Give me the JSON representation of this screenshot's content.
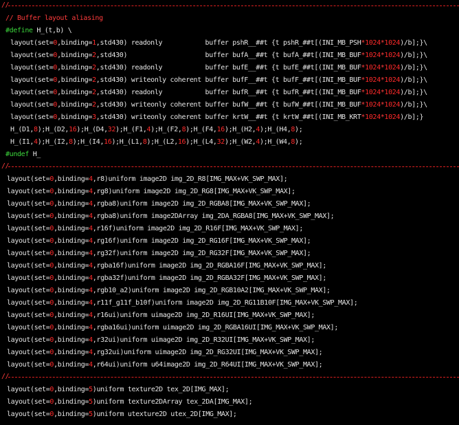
{
  "palette": {
    "background": "#000000",
    "text": "#e6e6e6",
    "number": "#ff2a2a",
    "comment": "#ff3c3c",
    "preprocessor": "#3cd83c"
  },
  "editor": {
    "lines": [
      {
        "kind": "sep",
        "text": "//"
      },
      {
        "kind": "code",
        "x": 8,
        "segments": [
          [
            "comment",
            "// Buffer layout aliasing"
          ]
        ]
      },
      {
        "kind": "code",
        "x": 8,
        "segments": [
          [
            "pp",
            "#define"
          ],
          [
            "plain",
            " H_(t,b) \\"
          ]
        ]
      },
      {
        "kind": "code",
        "x": 15,
        "segments": [
          [
            "plain",
            "layout(set="
          ],
          [
            "num",
            "0"
          ],
          [
            "plain",
            ",binding="
          ],
          [
            "num",
            "1"
          ],
          [
            "plain",
            ",std430) readonly           buffer pshR__##t {t pshR_##t[(INI_MB_PSH"
          ],
          [
            "op",
            "*"
          ],
          [
            "num",
            "1024"
          ],
          [
            "op",
            "*"
          ],
          [
            "num",
            "1024"
          ],
          [
            "plain",
            ")/b];}\\"
          ]
        ]
      },
      {
        "kind": "code",
        "x": 15,
        "segments": [
          [
            "plain",
            "layout(set="
          ],
          [
            "num",
            "0"
          ],
          [
            "plain",
            ",binding="
          ],
          [
            "num",
            "2"
          ],
          [
            "plain",
            ",std430)                    buffer bufA__##t {t bufA_##t[(INI_MB_BUF"
          ],
          [
            "op",
            "*"
          ],
          [
            "num",
            "1024"
          ],
          [
            "op",
            "*"
          ],
          [
            "num",
            "1024"
          ],
          [
            "plain",
            ")/b];}\\"
          ]
        ]
      },
      {
        "kind": "code",
        "x": 15,
        "segments": [
          [
            "plain",
            "layout(set="
          ],
          [
            "num",
            "0"
          ],
          [
            "plain",
            ",binding="
          ],
          [
            "num",
            "2"
          ],
          [
            "plain",
            ",std430) readonly           buffer bufE__##t {t bufE_##t[(INI_MB_BUF"
          ],
          [
            "op",
            "*"
          ],
          [
            "num",
            "1024"
          ],
          [
            "op",
            "*"
          ],
          [
            "num",
            "1024"
          ],
          [
            "plain",
            ")/b];}\\"
          ]
        ]
      },
      {
        "kind": "code",
        "x": 15,
        "segments": [
          [
            "plain",
            "layout(set="
          ],
          [
            "num",
            "0"
          ],
          [
            "plain",
            ",binding="
          ],
          [
            "num",
            "2"
          ],
          [
            "plain",
            ",std430) writeonly coherent buffer bufF__##t {t bufF_##t[(INI_MB_BUF"
          ],
          [
            "op",
            "*"
          ],
          [
            "num",
            "1024"
          ],
          [
            "op",
            "*"
          ],
          [
            "num",
            "1024"
          ],
          [
            "plain",
            ")/b];}\\"
          ]
        ]
      },
      {
        "kind": "code",
        "x": 15,
        "segments": [
          [
            "plain",
            "layout(set="
          ],
          [
            "num",
            "0"
          ],
          [
            "plain",
            ",binding="
          ],
          [
            "num",
            "2"
          ],
          [
            "plain",
            ",std430) readonly           buffer bufR__##t {t bufR_##t[(INI_MB_BUF"
          ],
          [
            "op",
            "*"
          ],
          [
            "num",
            "1024"
          ],
          [
            "op",
            "*"
          ],
          [
            "num",
            "1024"
          ],
          [
            "plain",
            ")/b];}\\"
          ]
        ]
      },
      {
        "kind": "code",
        "x": 15,
        "segments": [
          [
            "plain",
            "layout(set="
          ],
          [
            "num",
            "0"
          ],
          [
            "plain",
            ",binding="
          ],
          [
            "num",
            "2"
          ],
          [
            "plain",
            ",std430) writeonly coherent buffer bufW__##t {t bufW_##t[(INI_MB_BUF"
          ],
          [
            "op",
            "*"
          ],
          [
            "num",
            "1024"
          ],
          [
            "op",
            "*"
          ],
          [
            "num",
            "1024"
          ],
          [
            "plain",
            ")/b];}\\"
          ]
        ]
      },
      {
        "kind": "code",
        "x": 15,
        "segments": [
          [
            "plain",
            "layout(set="
          ],
          [
            "num",
            "0"
          ],
          [
            "plain",
            ",binding="
          ],
          [
            "num",
            "3"
          ],
          [
            "plain",
            ",std430) writeonly coherent buffer krtW__##t {t krtW_##t[(INI_MB_KRT"
          ],
          [
            "op",
            "*"
          ],
          [
            "num",
            "1024"
          ],
          [
            "op",
            "*"
          ],
          [
            "num",
            "1024"
          ],
          [
            "plain",
            ")/b];}"
          ]
        ]
      },
      {
        "kind": "code",
        "x": 15,
        "segments": [
          [
            "plain",
            "H_(D1,"
          ],
          [
            "num",
            "8"
          ],
          [
            "plain",
            ");H_(D2,"
          ],
          [
            "num",
            "16"
          ],
          [
            "plain",
            ");H_(D4,"
          ],
          [
            "num",
            "32"
          ],
          [
            "plain",
            ");H_(F1,"
          ],
          [
            "num",
            "4"
          ],
          [
            "plain",
            ");H_(F2,"
          ],
          [
            "num",
            "8"
          ],
          [
            "plain",
            ");H_(F4,"
          ],
          [
            "num",
            "16"
          ],
          [
            "plain",
            ");H_(H2,"
          ],
          [
            "num",
            "4"
          ],
          [
            "plain",
            ");H_(H4,"
          ],
          [
            "num",
            "8"
          ],
          [
            "plain",
            ");"
          ]
        ]
      },
      {
        "kind": "code",
        "x": 15,
        "segments": [
          [
            "plain",
            "H_(I1,"
          ],
          [
            "num",
            "4"
          ],
          [
            "plain",
            ");H_(I2,"
          ],
          [
            "num",
            "8"
          ],
          [
            "plain",
            ");H_(I4,"
          ],
          [
            "num",
            "16"
          ],
          [
            "plain",
            ");H_(L1,"
          ],
          [
            "num",
            "8"
          ],
          [
            "plain",
            ");H_(L2,"
          ],
          [
            "num",
            "16"
          ],
          [
            "plain",
            ");H_(L4,"
          ],
          [
            "num",
            "32"
          ],
          [
            "plain",
            ");H_(W2,"
          ],
          [
            "num",
            "4"
          ],
          [
            "plain",
            ");H_(W4,"
          ],
          [
            "num",
            "8"
          ],
          [
            "plain",
            ");"
          ]
        ]
      },
      {
        "kind": "code",
        "x": 8,
        "segments": [
          [
            "pp",
            "#undef"
          ],
          [
            "plain",
            " H_"
          ]
        ]
      },
      {
        "kind": "sep",
        "text": "//"
      },
      {
        "kind": "code",
        "x": 10,
        "segments": [
          [
            "plain",
            "layout(set="
          ],
          [
            "num",
            "0"
          ],
          [
            "plain",
            ",binding="
          ],
          [
            "num",
            "4"
          ],
          [
            "plain",
            ",r8)uniform image2D img_2D_R8[IMG_MAX+VK_SWP_MAX];"
          ]
        ]
      },
      {
        "kind": "code",
        "x": 10,
        "segments": [
          [
            "plain",
            "layout(set="
          ],
          [
            "num",
            "0"
          ],
          [
            "plain",
            ",binding="
          ],
          [
            "num",
            "4"
          ],
          [
            "plain",
            ",rg8)uniform image2D img_2D_RG8[IMG_MAX+VK_SWP_MAX];"
          ]
        ]
      },
      {
        "kind": "code",
        "x": 10,
        "segments": [
          [
            "plain",
            "layout(set="
          ],
          [
            "num",
            "0"
          ],
          [
            "plain",
            ",binding="
          ],
          [
            "num",
            "4"
          ],
          [
            "plain",
            ",rgba8)uniform image2D img_2D_RGBA8[IMG_MAX+VK_SWP_MAX];"
          ]
        ]
      },
      {
        "kind": "code",
        "x": 10,
        "segments": [
          [
            "plain",
            "layout(set="
          ],
          [
            "num",
            "0"
          ],
          [
            "plain",
            ",binding="
          ],
          [
            "num",
            "4"
          ],
          [
            "plain",
            ",rgba8)uniform image2DArray img_2DA_RGBA8[IMG_MAX+VK_SWP_MAX];"
          ]
        ]
      },
      {
        "kind": "code",
        "x": 10,
        "segments": [
          [
            "plain",
            "layout(set="
          ],
          [
            "num",
            "0"
          ],
          [
            "plain",
            ",binding="
          ],
          [
            "num",
            "4"
          ],
          [
            "plain",
            ",r16f)uniform image2D img_2D_R16F[IMG_MAX+VK_SWP_MAX];"
          ]
        ]
      },
      {
        "kind": "code",
        "x": 10,
        "segments": [
          [
            "plain",
            "layout(set="
          ],
          [
            "num",
            "0"
          ],
          [
            "plain",
            ",binding="
          ],
          [
            "num",
            "4"
          ],
          [
            "plain",
            ",rg16f)uniform image2D img_2D_RG16F[IMG_MAX+VK_SWP_MAX];"
          ]
        ]
      },
      {
        "kind": "code",
        "x": 10,
        "segments": [
          [
            "plain",
            "layout(set="
          ],
          [
            "num",
            "0"
          ],
          [
            "plain",
            ",binding="
          ],
          [
            "num",
            "4"
          ],
          [
            "plain",
            ",rg32f)uniform image2D img_2D_RG32F[IMG_MAX+VK_SWP_MAX];"
          ]
        ]
      },
      {
        "kind": "code",
        "x": 10,
        "segments": [
          [
            "plain",
            "layout(set="
          ],
          [
            "num",
            "0"
          ],
          [
            "plain",
            ",binding="
          ],
          [
            "num",
            "4"
          ],
          [
            "plain",
            ",rgba16f)uniform image2D img_2D_RGBA16F[IMG_MAX+VK_SWP_MAX];"
          ]
        ]
      },
      {
        "kind": "code",
        "x": 10,
        "segments": [
          [
            "plain",
            "layout(set="
          ],
          [
            "num",
            "0"
          ],
          [
            "plain",
            ",binding="
          ],
          [
            "num",
            "4"
          ],
          [
            "plain",
            ",rgba32f)uniform image2D img_2D_RGBA32F[IMG_MAX+VK_SWP_MAX];"
          ]
        ]
      },
      {
        "kind": "code",
        "x": 10,
        "segments": [
          [
            "plain",
            "layout(set="
          ],
          [
            "num",
            "0"
          ],
          [
            "plain",
            ",binding="
          ],
          [
            "num",
            "4"
          ],
          [
            "plain",
            ",rgb10_a2)uniform image2D img_2D_RGB10A2[IMG_MAX+VK_SWP_MAX];"
          ]
        ]
      },
      {
        "kind": "code",
        "x": 10,
        "segments": [
          [
            "plain",
            "layout(set="
          ],
          [
            "num",
            "0"
          ],
          [
            "plain",
            ",binding="
          ],
          [
            "num",
            "4"
          ],
          [
            "plain",
            ",r11f_g11f_b10f)uniform image2D img_2D_RG11B10F[IMG_MAX+VK_SWP_MAX];"
          ]
        ]
      },
      {
        "kind": "code",
        "x": 10,
        "segments": [
          [
            "plain",
            "layout(set="
          ],
          [
            "num",
            "0"
          ],
          [
            "plain",
            ",binding="
          ],
          [
            "num",
            "4"
          ],
          [
            "plain",
            ",r16ui)uniform uimage2D img_2D_R16UI[IMG_MAX+VK_SWP_MAX];"
          ]
        ]
      },
      {
        "kind": "code",
        "x": 10,
        "segments": [
          [
            "plain",
            "layout(set="
          ],
          [
            "num",
            "0"
          ],
          [
            "plain",
            ",binding="
          ],
          [
            "num",
            "4"
          ],
          [
            "plain",
            ",rgba16ui)uniform uimage2D img_2D_RGBA16UI[IMG_MAX+VK_SWP_MAX];"
          ]
        ]
      },
      {
        "kind": "code",
        "x": 10,
        "segments": [
          [
            "plain",
            "layout(set="
          ],
          [
            "num",
            "0"
          ],
          [
            "plain",
            ",binding="
          ],
          [
            "num",
            "4"
          ],
          [
            "plain",
            ",r32ui)uniform uimage2D img_2D_R32UI[IMG_MAX+VK_SWP_MAX];"
          ]
        ]
      },
      {
        "kind": "code",
        "x": 10,
        "segments": [
          [
            "plain",
            "layout(set="
          ],
          [
            "num",
            "0"
          ],
          [
            "plain",
            ",binding="
          ],
          [
            "num",
            "4"
          ],
          [
            "plain",
            ",rg32ui)uniform uimage2D img_2D_RG32UI[IMG_MAX+VK_SWP_MAX];"
          ]
        ]
      },
      {
        "kind": "code",
        "x": 10,
        "segments": [
          [
            "plain",
            "layout(set="
          ],
          [
            "num",
            "0"
          ],
          [
            "plain",
            ",binding="
          ],
          [
            "num",
            "4"
          ],
          [
            "plain",
            ",r64ui)uniform u64image2D img_2D_R64UI[IMG_MAX+VK_SWP_MAX];"
          ]
        ]
      },
      {
        "kind": "sep",
        "text": "//"
      },
      {
        "kind": "code",
        "x": 10,
        "segments": [
          [
            "plain",
            "layout(set="
          ],
          [
            "num",
            "0"
          ],
          [
            "plain",
            ",binding="
          ],
          [
            "num",
            "5"
          ],
          [
            "plain",
            ")uniform texture2D tex_2D[IMG_MAX];"
          ]
        ]
      },
      {
        "kind": "code",
        "x": 10,
        "segments": [
          [
            "plain",
            "layout(set="
          ],
          [
            "num",
            "0"
          ],
          [
            "plain",
            ",binding="
          ],
          [
            "num",
            "5"
          ],
          [
            "plain",
            ")uniform texture2DArray tex_2DA[IMG_MAX];"
          ]
        ]
      },
      {
        "kind": "code",
        "x": 10,
        "segments": [
          [
            "plain",
            "layout(set="
          ],
          [
            "num",
            "0"
          ],
          [
            "plain",
            ",binding="
          ],
          [
            "num",
            "5"
          ],
          [
            "plain",
            ")uniform utexture2D utex_2D[IMG_MAX];"
          ]
        ]
      }
    ]
  }
}
